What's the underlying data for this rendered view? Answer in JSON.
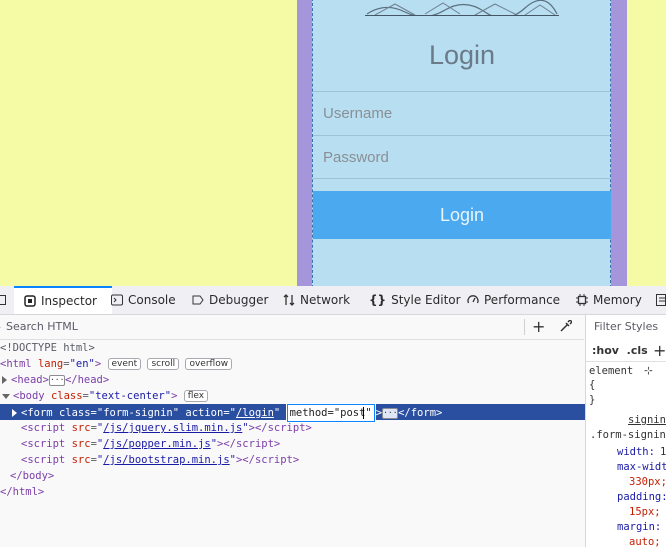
{
  "page": {
    "title": "Login",
    "username_placeholder": "Username",
    "password_placeholder": "Password",
    "button": "Login"
  },
  "devtools": {
    "tabs": [
      {
        "label": "Inspector",
        "icon": "inspector-icon"
      },
      {
        "label": "Console",
        "icon": "console-icon"
      },
      {
        "label": "Debugger",
        "icon": "debugger-icon"
      },
      {
        "label": "Network",
        "icon": "network-icon"
      },
      {
        "label": "Style Editor",
        "icon": "style-editor-icon"
      },
      {
        "label": "Performance",
        "icon": "performance-icon"
      },
      {
        "label": "Memory",
        "icon": "memory-icon"
      }
    ],
    "search_placeholder": "Search HTML",
    "markup": {
      "doctype": "<!DOCTYPE html>",
      "html_open": "<html",
      "html_attr": "lang",
      "html_val": "\"en\"",
      "html_close": ">",
      "badges": [
        "event",
        "scroll",
        "overflow"
      ],
      "head_open": "<head>",
      "head_close": "</head>",
      "body_open": "<body",
      "body_attr": "class",
      "body_val": "\"text-center\"",
      "body_close": ">",
      "body_badge": "flex",
      "form_open": "<form",
      "form_class_attr": "class",
      "form_class_val": "\"form-signin\"",
      "form_action_attr": "action",
      "form_action_val_pre": "\"",
      "form_action_link": "/login",
      "form_action_val_post": "\"",
      "form_method_edit": "method=\"post\"",
      "form_close_pre": ">",
      "form_close": "</form>",
      "scripts": [
        "/js/jquery.slim.min.js",
        "/js/popper.min.js",
        "/js/bootstrap.min.js"
      ],
      "body_end": "</body>",
      "html_end": "</html>"
    },
    "rules": {
      "filter_placeholder": "Filter Styles",
      "hov": ":hov",
      "cls": ".cls",
      "element": "element",
      "brace_open": "{",
      "brace_close": "}",
      "source": "signin",
      "selector": ".form-signin",
      "props": [
        {
          "name": "width:",
          "value": "1"
        },
        {
          "name": "max-widt",
          "value": "330px;"
        },
        {
          "name": "padding:",
          "value": "15px;"
        },
        {
          "name": "margin:",
          "value": "auto;"
        }
      ]
    }
  },
  "colors": {
    "page_bg": "#f4fba4",
    "frame": "#a596dc",
    "card": "#b7dff1",
    "button": "#4aa9ef",
    "selected_row": "#2a4fa0"
  }
}
